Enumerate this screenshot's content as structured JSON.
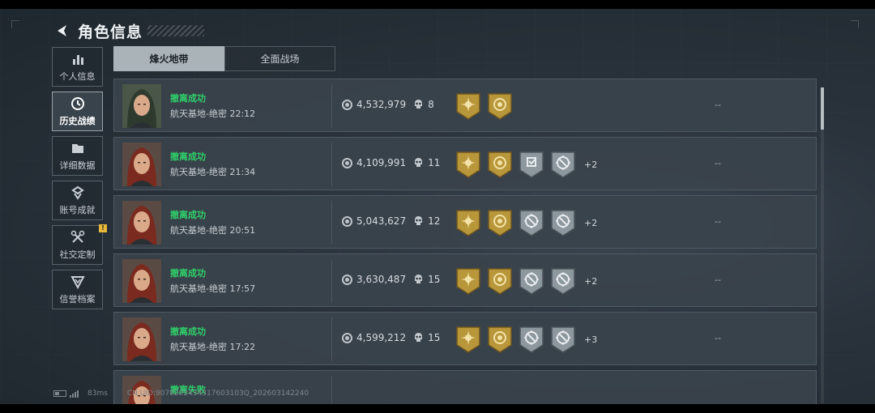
{
  "header": {
    "title": "角色信息"
  },
  "sidebar": {
    "items": [
      {
        "label": "个人信息",
        "icon": "bar-chart-icon",
        "active": false
      },
      {
        "label": "历史战绩",
        "icon": "history-icon",
        "active": true
      },
      {
        "label": "详细数据",
        "icon": "folder-icon",
        "active": false
      },
      {
        "label": "账号成就",
        "icon": "achievement-icon",
        "active": false
      },
      {
        "label": "社交定制",
        "icon": "tools-icon",
        "active": false,
        "badge": "!"
      },
      {
        "label": "信誉档案",
        "icon": "credit-shield-icon",
        "active": false
      }
    ]
  },
  "tabs": [
    {
      "label": "烽火地带",
      "active": true
    },
    {
      "label": "全面战场",
      "active": false
    }
  ],
  "matches": [
    {
      "result": "撤离成功",
      "map": "航天基地-绝密 22:12",
      "money": "4,532,979",
      "kills": "8",
      "medals": [
        "gold-sun",
        "gold-ring"
      ],
      "extra": "",
      "rating": "--",
      "avatar": "dark"
    },
    {
      "result": "撤离成功",
      "map": "航天基地-绝密 21:34",
      "money": "4,109,991",
      "kills": "11",
      "medals": [
        "gold-sun",
        "gold-ring",
        "silver-shield",
        "silver-target"
      ],
      "extra": "+2",
      "rating": "--",
      "avatar": "red"
    },
    {
      "result": "撤离成功",
      "map": "航天基地-绝密 20:51",
      "money": "5,043,627",
      "kills": "12",
      "medals": [
        "gold-sun",
        "gold-ring",
        "silver-target",
        "silver-target"
      ],
      "extra": "+2",
      "rating": "--",
      "avatar": "red"
    },
    {
      "result": "撤离成功",
      "map": "航天基地-绝密 17:57",
      "money": "3,630,487",
      "kills": "15",
      "medals": [
        "gold-sun",
        "gold-ring",
        "silver-target",
        "silver-target"
      ],
      "extra": "+2",
      "rating": "--",
      "avatar": "red"
    },
    {
      "result": "撤离成功",
      "map": "航天基地-绝密 17:22",
      "money": "4,599,212",
      "kills": "15",
      "medals": [
        "gold-sun",
        "gold-ring",
        "silver-target",
        "silver-target"
      ],
      "extra": "+3",
      "rating": "--",
      "avatar": "red"
    },
    {
      "result": "撤离失败",
      "map": "",
      "money": "",
      "kills": "",
      "medals": [],
      "extra": "",
      "rating": "",
      "avatar": "red"
    }
  ],
  "footer": {
    "ping": "83ms",
    "uid": "CN UID:9078202434317603103Q_202603142240"
  },
  "colors": {
    "success": "#2fd16a",
    "gold_medal": "#b8963a",
    "silver_medal": "#8d979e",
    "tab_active": "#a9b3b8"
  }
}
